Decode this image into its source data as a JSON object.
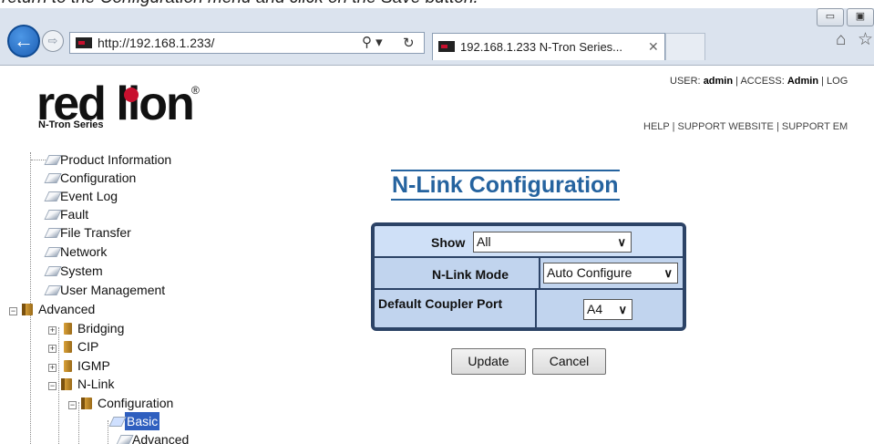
{
  "instruction": "return to the Configuration menu and click on the Save button.",
  "browser": {
    "url": "http://192.168.1.233/",
    "tab_title": "192.168.1.233 N-Tron Series...",
    "back_glyph": "←",
    "forward_glyph": "⇨",
    "search_glyph": "⚲ ▾",
    "reload_glyph": "↻",
    "close_glyph": "✕",
    "home_glyph": "⌂",
    "star_glyph": "☆",
    "minimize_glyph": "▭",
    "maximize_glyph": "▣"
  },
  "brand": {
    "logo_text": "red lion",
    "logo_sub": "N-Tron Series",
    "reg_mark": "®"
  },
  "header": {
    "user_label": "USER:",
    "user_value": "admin",
    "access_label": "ACCESS:",
    "access_value": "Admin",
    "logout": "LOG",
    "help": "HELP",
    "support_website": "SUPPORT WEBSITE",
    "support_email": "SUPPORT EM",
    "sep": "|"
  },
  "tree": {
    "items": [
      {
        "label": "Product Information"
      },
      {
        "label": "Configuration"
      },
      {
        "label": "Event Log"
      },
      {
        "label": "Fault"
      },
      {
        "label": "File Transfer"
      },
      {
        "label": "Network"
      },
      {
        "label": "System"
      },
      {
        "label": "User Management"
      },
      {
        "label": "Advanced"
      },
      {
        "label": "Bridging"
      },
      {
        "label": "CIP"
      },
      {
        "label": "IGMP"
      },
      {
        "label": "N-Link"
      },
      {
        "label": "Configuration"
      },
      {
        "label": "Basic"
      },
      {
        "label": "Advanced"
      }
    ],
    "expand_plus": "+",
    "expand_minus": "−"
  },
  "main": {
    "title": "N-Link Configuration",
    "form": {
      "show_label": "Show",
      "show_value": "All",
      "mode_label": "N-Link Mode",
      "mode_value": "Auto Configure",
      "coupler_label": "Default Coupler Port",
      "coupler_value": "A4",
      "chevron": "∨"
    },
    "update_label": "Update",
    "cancel_label": "Cancel"
  }
}
